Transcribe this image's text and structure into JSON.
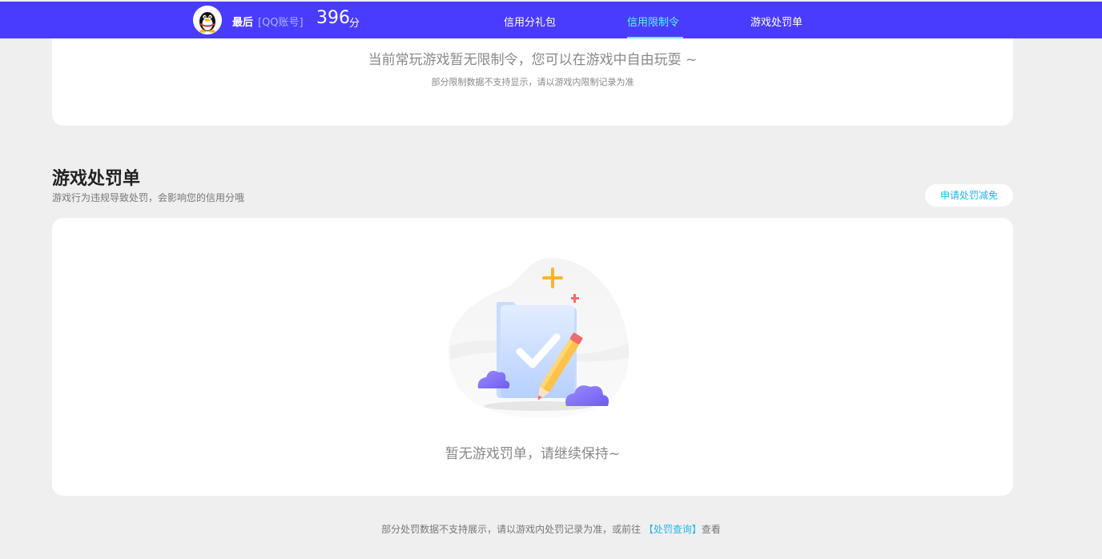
{
  "header": {
    "user_name": "最后",
    "account_type": "[QQ账号]",
    "score": "396",
    "score_unit": "分",
    "tabs": [
      {
        "label": "信用分礼包",
        "active": false
      },
      {
        "label": "信用限制令",
        "active": true
      },
      {
        "label": "游戏处罚单",
        "active": false
      }
    ]
  },
  "restriction_card": {
    "message": "当前常玩游戏暂无限制令，您可以在游戏中自由玩耍 ~",
    "note": "部分限制数据不支持显示，请以游戏内限制记录为准"
  },
  "penalty_section": {
    "title": "游戏处罚单",
    "subtitle": "游戏行为违规导致处罚，会影响您的信用分哦",
    "appeal_button": "申请处罚减免",
    "empty_message": "暂无游戏罚单，请继续保持~"
  },
  "footer": {
    "text_before": "部分处罚数据不支持展示，请以游戏内处罚记录为准，或前往 ",
    "link_text": "【处罚查询】",
    "text_after": "查看"
  },
  "colors": {
    "header_bg": "#4a3cff",
    "active_tab": "#5ff3ff",
    "link": "#2ab3e6",
    "page_bg": "#efefef"
  },
  "icons": [
    "qq-penguin-icon",
    "empty-folder-pencil-illustration"
  ]
}
